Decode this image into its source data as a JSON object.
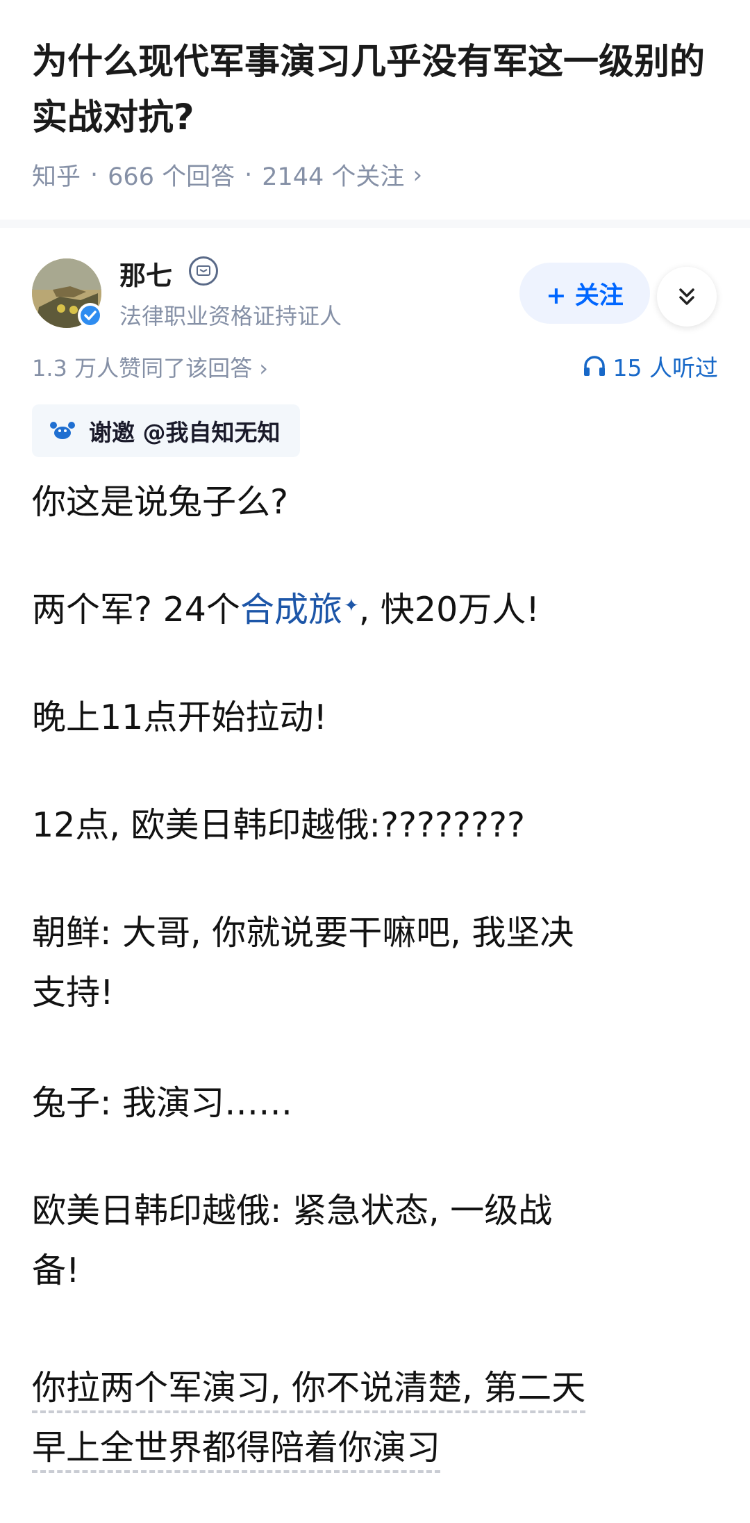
{
  "question": {
    "title": "为什么现代军事演习几乎没有军这一级别的实战对抗?",
    "source": "知乎",
    "answers": "666 个回答",
    "followers": "2144 个关注"
  },
  "author": {
    "name": "那七",
    "credential": "法律职业资格证持证人",
    "follow_label": "+ 关注"
  },
  "stats": {
    "votes": "1.3 万人赞同了该回答",
    "listened": "15 人听过"
  },
  "invite": {
    "text": "谢邀 @我自知无知"
  },
  "answer": {
    "p1": "你这是说兔子么?",
    "p2_before": "两个军? 24个",
    "p2_link": "合成旅",
    "p2_after": ", 快20万人!",
    "p3": "晚上11点开始拉动!",
    "p4": "12点, 欧美日韩印越俄:????????",
    "p5_line1": "朝鲜: 大哥, 你就说要干嘛吧, 我坚决",
    "p5_line2": "支持!",
    "p6": "兔子: 我演习……",
    "p7_line1": "欧美日韩印越俄: 紧急状态, 一级战",
    "p7_line2": "备!",
    "p8_line1": "你拉两个军演习, 你不说清楚, 第二天",
    "p8_line2": "早上全世界都得陪着你演习"
  }
}
